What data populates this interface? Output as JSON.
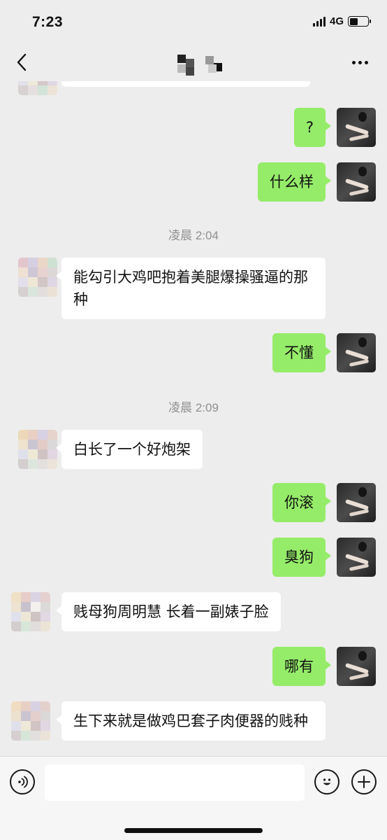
{
  "status_bar": {
    "time": "7:23",
    "network": "4G",
    "battery_level": 0.45
  },
  "nav": {
    "back_icon": "chevron-left-icon",
    "more_icon": "more-dots-icon"
  },
  "messages": [
    {
      "side": "self",
      "text": "?"
    },
    {
      "side": "self",
      "text": "什么样"
    },
    {
      "type": "time",
      "text": "凌晨 2:04"
    },
    {
      "side": "other",
      "text": "能勾引大鸡吧抱着美腿爆操骚逼的那种"
    },
    {
      "side": "self",
      "text": "不懂"
    },
    {
      "type": "time",
      "text": "凌晨 2:09"
    },
    {
      "side": "other",
      "text": "白长了一个好炮架"
    },
    {
      "side": "self",
      "text": "你滚"
    },
    {
      "side": "self",
      "text": "臭狗"
    },
    {
      "side": "other",
      "text": "贱母狗周明慧 长着一副婊子脸"
    },
    {
      "side": "self",
      "text": "哪有"
    },
    {
      "side": "other",
      "text": "生下来就是做鸡巴套子肉便器的贱种"
    }
  ],
  "input_bar": {
    "voice_icon": "voice-icon",
    "emoji_icon": "emoji-icon",
    "add_icon": "plus-icon",
    "placeholder": ""
  },
  "colors": {
    "background": "#ededed",
    "self_bubble": "#95ec69",
    "other_bubble": "#ffffff",
    "time_text": "#8f8f8f"
  }
}
